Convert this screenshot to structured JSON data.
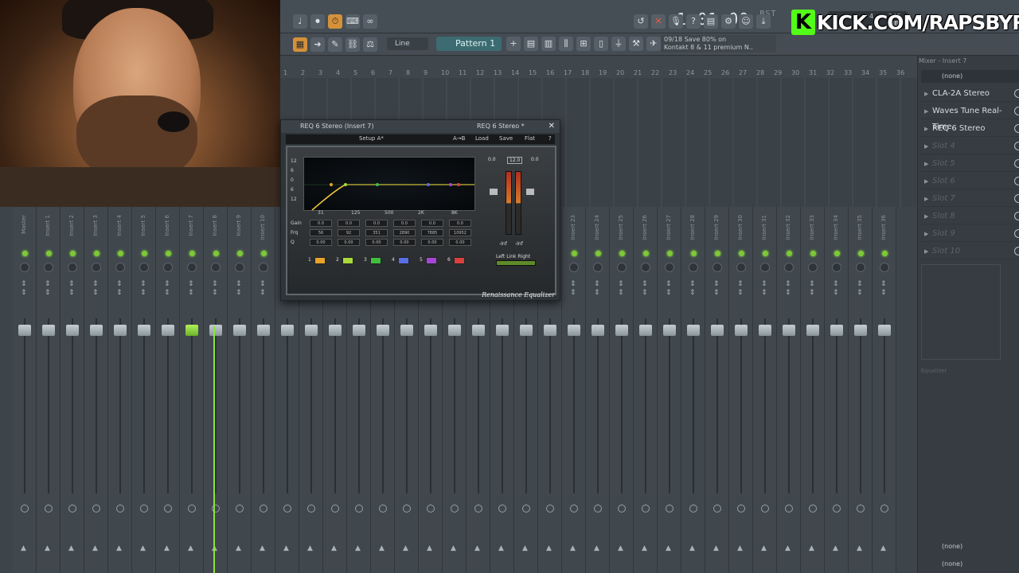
{
  "stream_banner": {
    "brand_letter": "K",
    "url_text": "KICK.COM/RAPSBYRC",
    "brand_color": "#53fc18"
  },
  "toolbar": {
    "time_display": "1:01:00",
    "time_suffix": "BST",
    "cpu_value": "4",
    "memory": "246 MB",
    "voices": "0",
    "snap_mode": "Line",
    "pattern_label": "Pattern 1",
    "hint_line1": "09/18  Save 80% on",
    "hint_line2": "Kontakt 8 & 11 premium N.."
  },
  "ruler": {
    "bars": [
      "1",
      "2",
      "3",
      "4",
      "5",
      "6",
      "7",
      "8",
      "9",
      "10",
      "11",
      "12",
      "13",
      "14",
      "15",
      "16",
      "17",
      "18",
      "19",
      "20",
      "21",
      "22",
      "23",
      "24",
      "25",
      "26",
      "27",
      "28",
      "29",
      "30",
      "31",
      "32",
      "33",
      "34",
      "35",
      "36"
    ]
  },
  "mixer": {
    "strips": [
      {
        "name": "Master",
        "active": false
      },
      {
        "name": "Insert 1",
        "active": false
      },
      {
        "name": "Insert 2",
        "active": false
      },
      {
        "name": "Insert 3",
        "active": false
      },
      {
        "name": "Insert 4",
        "active": false
      },
      {
        "name": "Insert 5",
        "active": false
      },
      {
        "name": "Insert 6",
        "active": false
      },
      {
        "name": "Insert 7",
        "active": true
      },
      {
        "name": "Insert 8",
        "active": false
      },
      {
        "name": "Insert 9",
        "active": false
      },
      {
        "name": "Insert 10",
        "active": false
      },
      {
        "name": "Insert 11",
        "active": false
      },
      {
        "name": "Insert 12",
        "active": false
      },
      {
        "name": "Insert 13",
        "active": false
      },
      {
        "name": "Insert 14",
        "active": false
      },
      {
        "name": "Insert 15",
        "active": false
      },
      {
        "name": "Insert 16",
        "active": false
      },
      {
        "name": "Insert 17",
        "active": false
      },
      {
        "name": "Insert 18",
        "active": false
      },
      {
        "name": "Insert 19",
        "active": false
      },
      {
        "name": "Insert 20",
        "active": false
      },
      {
        "name": "Insert 21",
        "active": false
      },
      {
        "name": "Insert 22",
        "active": false
      },
      {
        "name": "Insert 23",
        "active": false
      },
      {
        "name": "Insert 24",
        "active": false
      },
      {
        "name": "Insert 25",
        "active": false
      },
      {
        "name": "Insert 26",
        "active": false
      },
      {
        "name": "Insert 27",
        "active": false
      },
      {
        "name": "Insert 28",
        "active": false
      },
      {
        "name": "Insert 29",
        "active": false
      },
      {
        "name": "Insert 30",
        "active": false
      },
      {
        "name": "Insert 31",
        "active": false
      },
      {
        "name": "Insert 32",
        "active": false
      },
      {
        "name": "Insert 33",
        "active": false
      },
      {
        "name": "Insert 34",
        "active": false
      },
      {
        "name": "Insert 35",
        "active": false
      },
      {
        "name": "Insert 36",
        "active": false
      }
    ]
  },
  "right_panel": {
    "title": "Mixer - Insert 7",
    "input_select": "(none)",
    "slots": [
      {
        "label": "CLA-2A Stereo",
        "empty": false
      },
      {
        "label": "Waves Tune Real-Time..",
        "empty": false
      },
      {
        "label": "REQ 6 Stereo",
        "empty": false
      },
      {
        "label": "Slot 4",
        "empty": true
      },
      {
        "label": "Slot 5",
        "empty": true
      },
      {
        "label": "Slot 6",
        "empty": true
      },
      {
        "label": "Slot 7",
        "empty": true
      },
      {
        "label": "Slot 8",
        "empty": true
      },
      {
        "label": "Slot 9",
        "empty": true
      },
      {
        "label": "Slot 10",
        "empty": true
      }
    ],
    "eq_label": "Equalizer",
    "output_select_1": "(none)",
    "output_select_2": "(none)"
  },
  "plugin": {
    "title": "REQ 6 Stereo (Insert 7)",
    "title_right": "REQ 6 Stereo *",
    "preset": "Setup A*",
    "compare": "A→B",
    "load": "Load",
    "save": "Save",
    "flat": "Flat",
    "help": "?",
    "graph_y_labels": [
      "12",
      "6",
      "0",
      "6",
      "12"
    ],
    "graph_x_labels": [
      "31",
      "125",
      "500",
      "2K",
      "8K"
    ],
    "param_labels": [
      "Gain",
      "Frq",
      "Q"
    ],
    "gain_values": [
      "0.0",
      "0.0",
      "0.0",
      "0.0",
      "0.0",
      "0.0"
    ],
    "freq_values": [
      "56",
      "92",
      "351",
      "2890",
      "7885",
      "10952"
    ],
    "q_values": [
      "0.00",
      "0.00",
      "0.00",
      "0.00",
      "0.00",
      "0.00"
    ],
    "band_numbers": [
      "1",
      "2",
      "3",
      "4",
      "5",
      "6"
    ],
    "band_colors": [
      "#e8a329",
      "#a8d93a",
      "#3fbf3f",
      "#5a6ee8",
      "#a646d8",
      "#d94040"
    ],
    "meter_top_left": "0.0",
    "meter_top_mid": "12.0",
    "meter_top_right": "0.0",
    "meter_bottom_left": "-Inf",
    "meter_bottom_right": "-Inf",
    "link_label": "Left Link Right",
    "brand": "Renaissance Equalizer"
  }
}
